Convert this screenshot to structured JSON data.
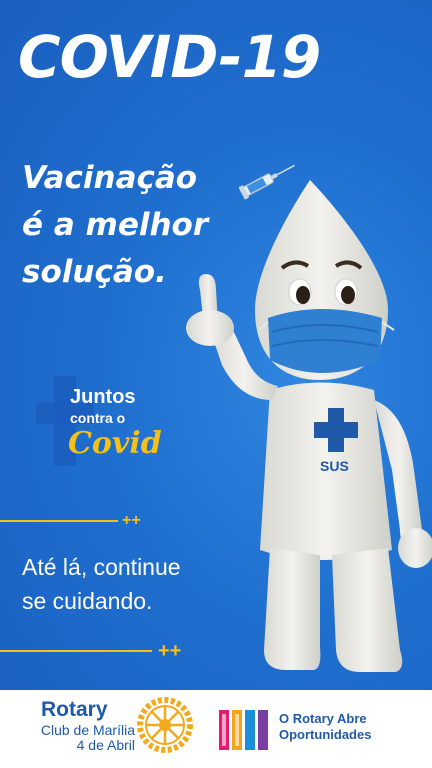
{
  "poster": {
    "title": "COVID-19",
    "headline_lines": [
      "Vacinação",
      "é a melhor",
      "solução."
    ],
    "campaign": {
      "line1": "Juntos",
      "line2": "contra o",
      "line3": "Covid"
    },
    "subtext_lines": [
      "Até lá, continue",
      "se cuidando."
    ],
    "decor_plus": "++",
    "mascot_badge": "SUS",
    "colors": {
      "background": "#1f6fcf",
      "accent_yellow": "#f5c018",
      "mask_blue": "#2f7fd3",
      "text": "#ffffff"
    }
  },
  "footer": {
    "brand": "Rotary",
    "club_lines": [
      "Club de Marília",
      "4 de Abril"
    ],
    "tagline_lines": [
      "O Rotary Abre",
      "Oportunidades"
    ],
    "colors": {
      "brand_blue": "#1f5aa8",
      "wheel_gold": "#f2a91c"
    }
  }
}
